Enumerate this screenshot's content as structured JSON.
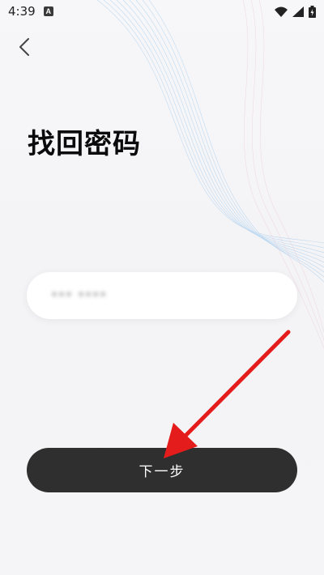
{
  "status_bar": {
    "time": "4:39",
    "app_icon_letter": "A",
    "icons": [
      "wifi-icon",
      "signal-icon",
      "battery-charging-icon"
    ]
  },
  "header": {
    "back_icon": "chevron-left-icon"
  },
  "page": {
    "title": "找回密码"
  },
  "form": {
    "phone_value": "*** ****"
  },
  "actions": {
    "next_label": "下一步"
  },
  "colors": {
    "button_bg": "#2f2f2f",
    "arrow_red": "#e51c1c",
    "wave_blue": "#8fc3ec"
  }
}
